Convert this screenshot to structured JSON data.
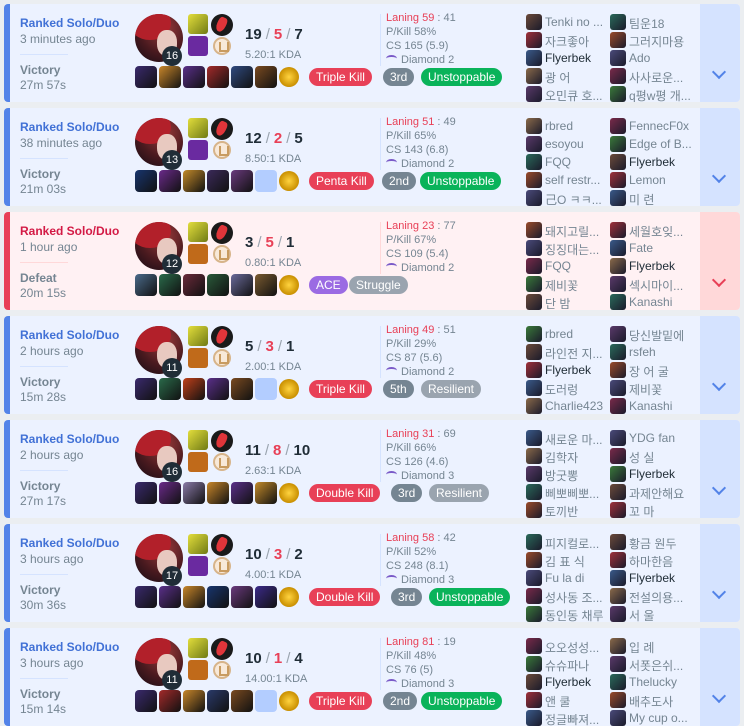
{
  "colors": {
    "win_accent": "#5383e8",
    "loss_accent": "#e84057",
    "win_bg": "#ecf2ff",
    "loss_bg": "#fff1f3"
  },
  "icons": {
    "expand": "chevron-down-icon",
    "tier": "diamond-emblem-icon"
  },
  "matches": [
    {
      "mode": "Ranked Solo/Duo",
      "ago": "3 minutes ago",
      "result": "Victory",
      "duration": "27m 57s",
      "level": "16",
      "kills": "19",
      "deaths": "5",
      "assists": "7",
      "kda": "5.20:1 KDA",
      "tags": [
        {
          "label": "Triple Kill",
          "color": "red"
        },
        {
          "label": "3rd",
          "color": "dgray"
        },
        {
          "label": "Unstoppable",
          "color": "green"
        }
      ],
      "stats": {
        "laning": "Laning 59",
        "laning_opp": "41",
        "pkill": "P/Kill 58%",
        "cs": "CS 165 (5.9)",
        "tier": "Diamond 2"
      },
      "team1": [
        "Tenki no ...",
        "자크좋아",
        "Flyerbek",
        "광 어",
        "오민큐 호..."
      ],
      "team2": [
        "팀운18",
        "그러지마용",
        "Ado",
        "사사로운...",
        "q평w평 개..."
      ]
    },
    {
      "mode": "Ranked Solo/Duo",
      "ago": "38 minutes ago",
      "result": "Victory",
      "duration": "21m 03s",
      "level": "13",
      "kills": "12",
      "deaths": "2",
      "assists": "5",
      "kda": "8.50:1 KDA",
      "tags": [
        {
          "label": "Penta Kill",
          "color": "red"
        },
        {
          "label": "2nd",
          "color": "dgray"
        },
        {
          "label": "Unstoppable",
          "color": "green"
        }
      ],
      "stats": {
        "laning": "Laning 51",
        "laning_opp": "49",
        "pkill": "P/Kill 65%",
        "cs": "CS 143 (6.8)",
        "tier": "Diamond 2"
      },
      "team1": [
        "rbred",
        "esoyou",
        "FQQ",
        "self restr...",
        "己О ㅋㅋ..."
      ],
      "team2": [
        "FennecF0x",
        "Edge of B...",
        "Flyerbek",
        "Lemon",
        "미 련"
      ]
    },
    {
      "mode": "Ranked Solo/Duo",
      "ago": "1 hour ago",
      "result": "Defeat",
      "duration": "20m 15s",
      "level": "12",
      "kills": "3",
      "deaths": "5",
      "assists": "1",
      "kda": "0.80:1 KDA",
      "tags": [
        {
          "label": "ACE",
          "color": "purple"
        },
        {
          "label": "Struggle",
          "color": "gray"
        }
      ],
      "stats": {
        "laning": "Laning 23",
        "laning_opp": "77",
        "pkill": "P/Kill 67%",
        "cs": "CS 109 (5.4)",
        "tier": "Diamond 2"
      },
      "team1": [
        "돼지고릴...",
        "징징대는...",
        "FQQ",
        "제비꽃",
        "단 밤"
      ],
      "team2": [
        "세월호잊...",
        "Fate",
        "Flyerbek",
        "섹시마이...",
        "Kanashi"
      ]
    },
    {
      "mode": "Ranked Solo/Duo",
      "ago": "2 hours ago",
      "result": "Victory",
      "duration": "15m 28s",
      "level": "11",
      "kills": "5",
      "deaths": "3",
      "assists": "1",
      "kda": "2.00:1 KDA",
      "tags": [
        {
          "label": "Triple Kill",
          "color": "red"
        },
        {
          "label": "5th",
          "color": "dgray"
        },
        {
          "label": "Resilient",
          "color": "gray"
        }
      ],
      "stats": {
        "laning": "Laning 49",
        "laning_opp": "51",
        "pkill": "P/Kill 29%",
        "cs": "CS 87 (5.6)",
        "tier": "Diamond 2"
      },
      "team1": [
        "rbred",
        "라인전 지...",
        "Flyerbek",
        "도러렁",
        "Charlie423"
      ],
      "team2": [
        "당신발밑에",
        "rsfeh",
        "장 어 굴",
        "제비꽃",
        "Kanashi"
      ]
    },
    {
      "mode": "Ranked Solo/Duo",
      "ago": "2 hours ago",
      "result": "Victory",
      "duration": "27m 17s",
      "level": "16",
      "kills": "11",
      "deaths": "8",
      "assists": "10",
      "kda": "2.63:1 KDA",
      "tags": [
        {
          "label": "Double Kill",
          "color": "red"
        },
        {
          "label": "3rd",
          "color": "dgray"
        },
        {
          "label": "Resilient",
          "color": "gray"
        }
      ],
      "stats": {
        "laning": "Laning 31",
        "laning_opp": "69",
        "pkill": "P/Kill 66%",
        "cs": "CS 126 (4.6)",
        "tier": "Diamond 3"
      },
      "team1": [
        "새로운 마...",
        "김학자",
        "방굿뽕",
        "삐뽀삐뽀...",
        "토끼반"
      ],
      "team2": [
        "YDG fan",
        "성 실",
        "Flyerbek",
        "과제안해요",
        "꼬 마"
      ]
    },
    {
      "mode": "Ranked Solo/Duo",
      "ago": "3 hours ago",
      "result": "Victory",
      "duration": "30m 36s",
      "level": "17",
      "kills": "10",
      "deaths": "3",
      "assists": "2",
      "kda": "4.00:1 KDA",
      "tags": [
        {
          "label": "Double Kill",
          "color": "red"
        },
        {
          "label": "3rd",
          "color": "dgray"
        },
        {
          "label": "Unstoppable",
          "color": "green"
        }
      ],
      "stats": {
        "laning": "Laning 58",
        "laning_opp": "42",
        "pkill": "P/Kill 52%",
        "cs": "CS 248 (8.1)",
        "tier": "Diamond 3"
      },
      "team1": [
        "피지컬로...",
        "김 표 식",
        "Fu la di",
        "성사동 조...",
        "동인동 채루"
      ],
      "team2": [
        "황금 원두",
        "하마한음",
        "Flyerbek",
        "전설의용...",
        "서 울"
      ]
    },
    {
      "mode": "Ranked Solo/Duo",
      "ago": "3 hours ago",
      "result": "Victory",
      "duration": "15m 14s",
      "level": "11",
      "kills": "10",
      "deaths": "1",
      "assists": "4",
      "kda": "14.00:1 KDA",
      "tags": [
        {
          "label": "Triple Kill",
          "color": "red"
        },
        {
          "label": "2nd",
          "color": "dgray"
        },
        {
          "label": "Unstoppable",
          "color": "green"
        }
      ],
      "stats": {
        "laning": "Laning 81",
        "laning_opp": "19",
        "pkill": "P/Kill 48%",
        "cs": "CS 76 (5)",
        "tier": "Diamond 3"
      },
      "team1": [
        "오오성성...",
        "슈슈파나",
        "Flyerbek",
        "앤 쿨",
        "정글빠져..."
      ],
      "team2": [
        "입 례",
        "서폿은쉬...",
        "Thelucky",
        "배추도사",
        "My cup o..."
      ]
    }
  ]
}
